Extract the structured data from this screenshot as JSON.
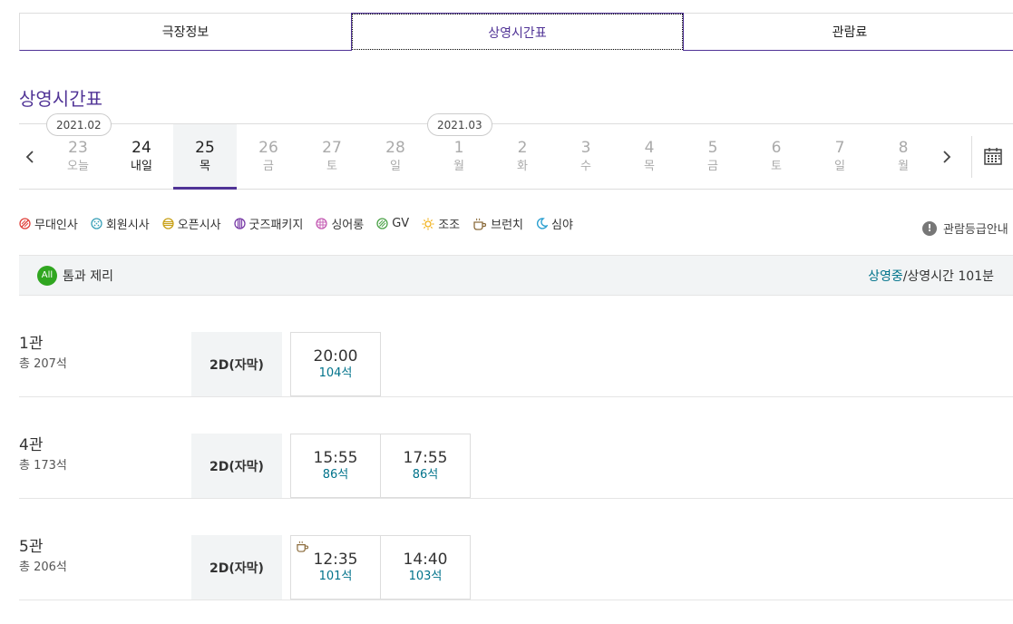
{
  "tabs": [
    {
      "label": "극장정보"
    },
    {
      "label": "상영시간표"
    },
    {
      "label": "관람료"
    }
  ],
  "page_title": "상영시간표",
  "months": [
    {
      "label": "2021.02"
    },
    {
      "label": "2021.03"
    }
  ],
  "days": [
    {
      "num": "23",
      "dow": "오늘"
    },
    {
      "num": "24",
      "dow": "내일"
    },
    {
      "num": "25",
      "dow": "목"
    },
    {
      "num": "26",
      "dow": "금"
    },
    {
      "num": "27",
      "dow": "토"
    },
    {
      "num": "28",
      "dow": "일"
    },
    {
      "num": "1",
      "dow": "월"
    },
    {
      "num": "2",
      "dow": "화"
    },
    {
      "num": "3",
      "dow": "수"
    },
    {
      "num": "4",
      "dow": "목"
    },
    {
      "num": "5",
      "dow": "금"
    },
    {
      "num": "6",
      "dow": "토"
    },
    {
      "num": "7",
      "dow": "일"
    },
    {
      "num": "8",
      "dow": "월"
    }
  ],
  "legend": [
    {
      "label": "무대인사",
      "icon": "stage-greeting-icon",
      "color": "#e0433d"
    },
    {
      "label": "회원시사",
      "icon": "member-preview-icon",
      "color": "#3aa0b8"
    },
    {
      "label": "오픈시사",
      "icon": "open-preview-icon",
      "color": "#c9a21c"
    },
    {
      "label": "굿즈패키지",
      "icon": "goods-package-icon",
      "color": "#7b3fa8"
    },
    {
      "label": "싱어롱",
      "icon": "singalong-icon",
      "color": "#c45ab3"
    },
    {
      "label": "GV",
      "icon": "gv-icon",
      "color": "#4ea34a"
    },
    {
      "label": "조조",
      "icon": "sun-icon",
      "color": "#f2b21c"
    },
    {
      "label": "브런치",
      "icon": "coffee-cup-icon",
      "color": "#8a6a3a"
    },
    {
      "label": "심야",
      "icon": "moon-icon",
      "color": "#2a9fd0"
    }
  ],
  "grade_guide": "관람등급안내",
  "movie": {
    "rating": "All",
    "title": "톰과 제리",
    "status_on": "상영중",
    "status_rest": "/상영시간 101분"
  },
  "halls": [
    {
      "name": "1관",
      "seats": "총 207석",
      "format": "2D(자막)",
      "slots": [
        {
          "time": "20:00",
          "seats": "104석",
          "brunch": false
        }
      ]
    },
    {
      "name": "4관",
      "seats": "총 173석",
      "format": "2D(자막)",
      "slots": [
        {
          "time": "15:55",
          "seats": "86석",
          "brunch": false
        },
        {
          "time": "17:55",
          "seats": "86석",
          "brunch": false
        }
      ]
    },
    {
      "name": "5관",
      "seats": "총 206석",
      "format": "2D(자막)",
      "slots": [
        {
          "time": "12:35",
          "seats": "101석",
          "brunch": true
        },
        {
          "time": "14:40",
          "seats": "103석",
          "brunch": false
        }
      ]
    }
  ],
  "colors": {
    "accent": "#503396",
    "teal": "#01738b",
    "rating_all": "#30a620"
  }
}
